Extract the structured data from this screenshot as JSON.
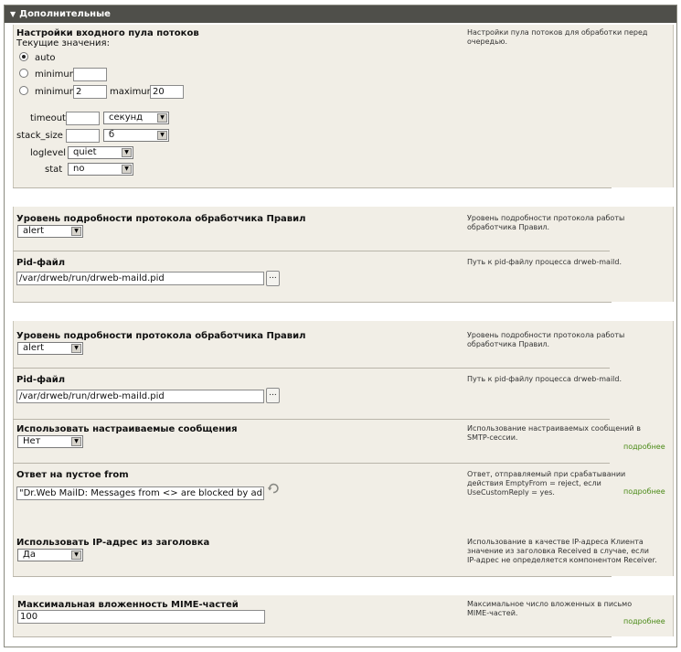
{
  "header": {
    "title": "Дополнительные"
  },
  "pool": {
    "title": "Настройки входного пула потоков",
    "current_label": "Текущие значения:",
    "desc": "Настройки пула потоков для обработки перед очередью.",
    "radio_auto": "auto",
    "radio_min": "minimum",
    "radio_min2": "minimum",
    "radio_max": "maximum",
    "min_value": "2",
    "max_value": "20",
    "timeout_label": "timeout",
    "timeout_unit": "секунд",
    "stack_label": "stack_size",
    "stack_unit": "б",
    "loglevel_label": "loglevel",
    "loglevel_value": "quiet",
    "stat_label": "stat",
    "stat_value": "no"
  },
  "block2": {
    "level_title": "Уровень подробности протокола обработчика Правил",
    "level_value": "alert",
    "level_desc": "Уровень подробности протокола работы обработчика Правил.",
    "pid_title": "Pid-файл",
    "pid_value": "/var/drweb/run/drweb-maild.pid",
    "pid_desc": "Путь к pid-файлу процесса drweb-maild.",
    "browse": "..."
  },
  "block3": {
    "level_title": "Уровень подробности протокола обработчика Правил",
    "level_value": "alert",
    "level_desc": "Уровень подробности протокола работы обработчика Правил.",
    "pid_title": "Pid-файл",
    "pid_value": "/var/drweb/run/drweb-maild.pid",
    "pid_desc": "Путь к pid-файлу процесса drweb-maild.",
    "browse": "...",
    "custom_title": "Использовать настраиваемые сообщения",
    "custom_value": "Нет",
    "custom_desc": "Использование настраиваемых сообщений в SMTP-сессии.",
    "custom_more": "подробнее",
    "empty_title": "Ответ на пустое from",
    "empty_value": "\"Dr.Web MailD: Messages from <> are blocked by administrator",
    "empty_desc": "Ответ, отправляемый при срабатывании действия EmptyFrom = reject, если UseCustomReply = yes.",
    "empty_more": "подробнее"
  },
  "block4": {
    "ip_title": "Использовать IP-адрес из заголовка",
    "ip_value": "Да",
    "ip_desc": "Использование в качестве IP-адреса Клиента значение из заголовка Received в случае, если IP-адрес не определяется компонентом Receiver."
  },
  "block5": {
    "mime_title": "Максимальная вложенность MIME-частей",
    "mime_value": "100",
    "mime_desc": "Максимальное число вложенных в письмо MIME-частей.",
    "mime_more": "подробнее"
  }
}
